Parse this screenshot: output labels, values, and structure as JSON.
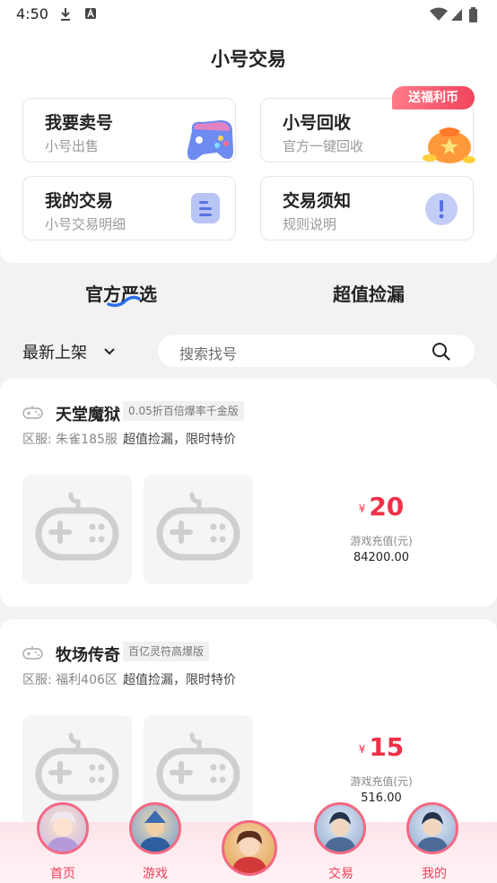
{
  "status_bar": {
    "time": "4:50"
  },
  "page": {
    "title": "小号交易"
  },
  "tiles": [
    {
      "title": "我要卖号",
      "subtitle": "小号出售",
      "icon": "gamepad-icon"
    },
    {
      "title": "小号回收",
      "subtitle": "官方一键回收",
      "icon": "money-bag-icon",
      "badge": "送福利币"
    },
    {
      "title": "我的交易",
      "subtitle": "小号交易明细",
      "icon": "document-list-icon"
    },
    {
      "title": "交易须知",
      "subtitle": "规则说明",
      "icon": "exclamation-icon"
    }
  ],
  "tabs": [
    {
      "label": "官方严选",
      "active": true
    },
    {
      "label": "超值捡漏",
      "active": false
    }
  ],
  "filter": {
    "sort_label": "最新上架",
    "search_placeholder": "搜索找号"
  },
  "listings": [
    {
      "game": "天堂魔狱",
      "tag": "0.05折百倍爆率千金版",
      "server": "区服: 朱雀185服",
      "description": "超值捡漏，限时特价",
      "currency": "¥",
      "price": "20",
      "recharge_label": "游戏充值(元)",
      "recharge_value": "84200.00"
    },
    {
      "game": "牧场传奇",
      "tag": "百亿灵符高爆版",
      "server": "区服: 福利406区",
      "description": "超值捡漏，限时特价",
      "currency": "¥",
      "price": "15",
      "recharge_label": "游戏充值(元)",
      "recharge_value": "516.00"
    }
  ],
  "bottom_nav": [
    {
      "label": "首页"
    },
    {
      "label": "游戏"
    },
    {
      "label": ""
    },
    {
      "label": "交易"
    },
    {
      "label": "我的"
    }
  ],
  "colors": {
    "accent": "#f03048",
    "badge": "#f2445d",
    "tile_icon": "#b9c5f5"
  }
}
